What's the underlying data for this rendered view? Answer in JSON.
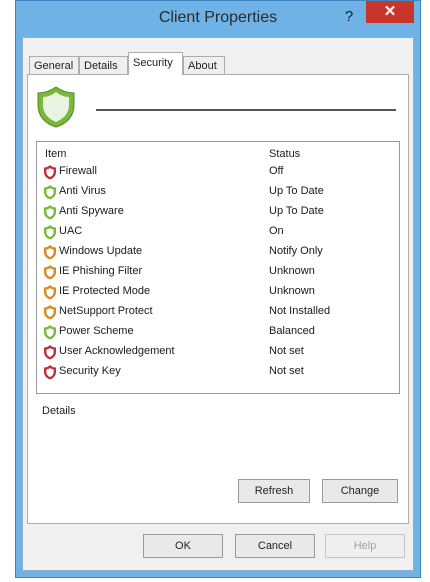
{
  "window": {
    "title": "Client Properties",
    "help": "?",
    "close": "✕"
  },
  "tabs": [
    {
      "label": "General"
    },
    {
      "label": "Details"
    },
    {
      "label": "Security"
    },
    {
      "label": "About"
    }
  ],
  "list": {
    "col_item": "Item",
    "col_status": "Status",
    "rows": [
      {
        "item": "Firewall",
        "status": "Off",
        "icon": "shield-red-icon"
      },
      {
        "item": "Anti Virus",
        "status": "Up To Date",
        "icon": "shield-green-icon"
      },
      {
        "item": "Anti Spyware",
        "status": "Up To Date",
        "icon": "shield-green-icon"
      },
      {
        "item": "UAC",
        "status": "On",
        "icon": "shield-green-icon"
      },
      {
        "item": "Windows Update",
        "status": "Notify Only",
        "icon": "shield-orange-icon"
      },
      {
        "item": "IE Phishing Filter",
        "status": "Unknown",
        "icon": "shield-orange-icon"
      },
      {
        "item": "IE Protected Mode",
        "status": "Unknown",
        "icon": "shield-orange-icon"
      },
      {
        "item": "NetSupport Protect",
        "status": "Not Installed",
        "icon": "shield-orange-icon"
      },
      {
        "item": "Power Scheme",
        "status": "Balanced",
        "icon": "shield-green-icon"
      },
      {
        "item": "User Acknowledgement",
        "status": "Not set",
        "icon": "shield-red-icon"
      },
      {
        "item": "Security Key",
        "status": "Not set",
        "icon": "shield-red-icon"
      }
    ]
  },
  "details": {
    "label": "Details"
  },
  "buttons": {
    "refresh": "Refresh",
    "change": "Change",
    "ok": "OK",
    "cancel": "Cancel",
    "help": "Help"
  },
  "colors": {
    "titlebar": "#6fb2e6",
    "close": "#c8352b",
    "shield_red": "#c0303c",
    "shield_green": "#79b83a",
    "shield_orange": "#d98a1e"
  }
}
